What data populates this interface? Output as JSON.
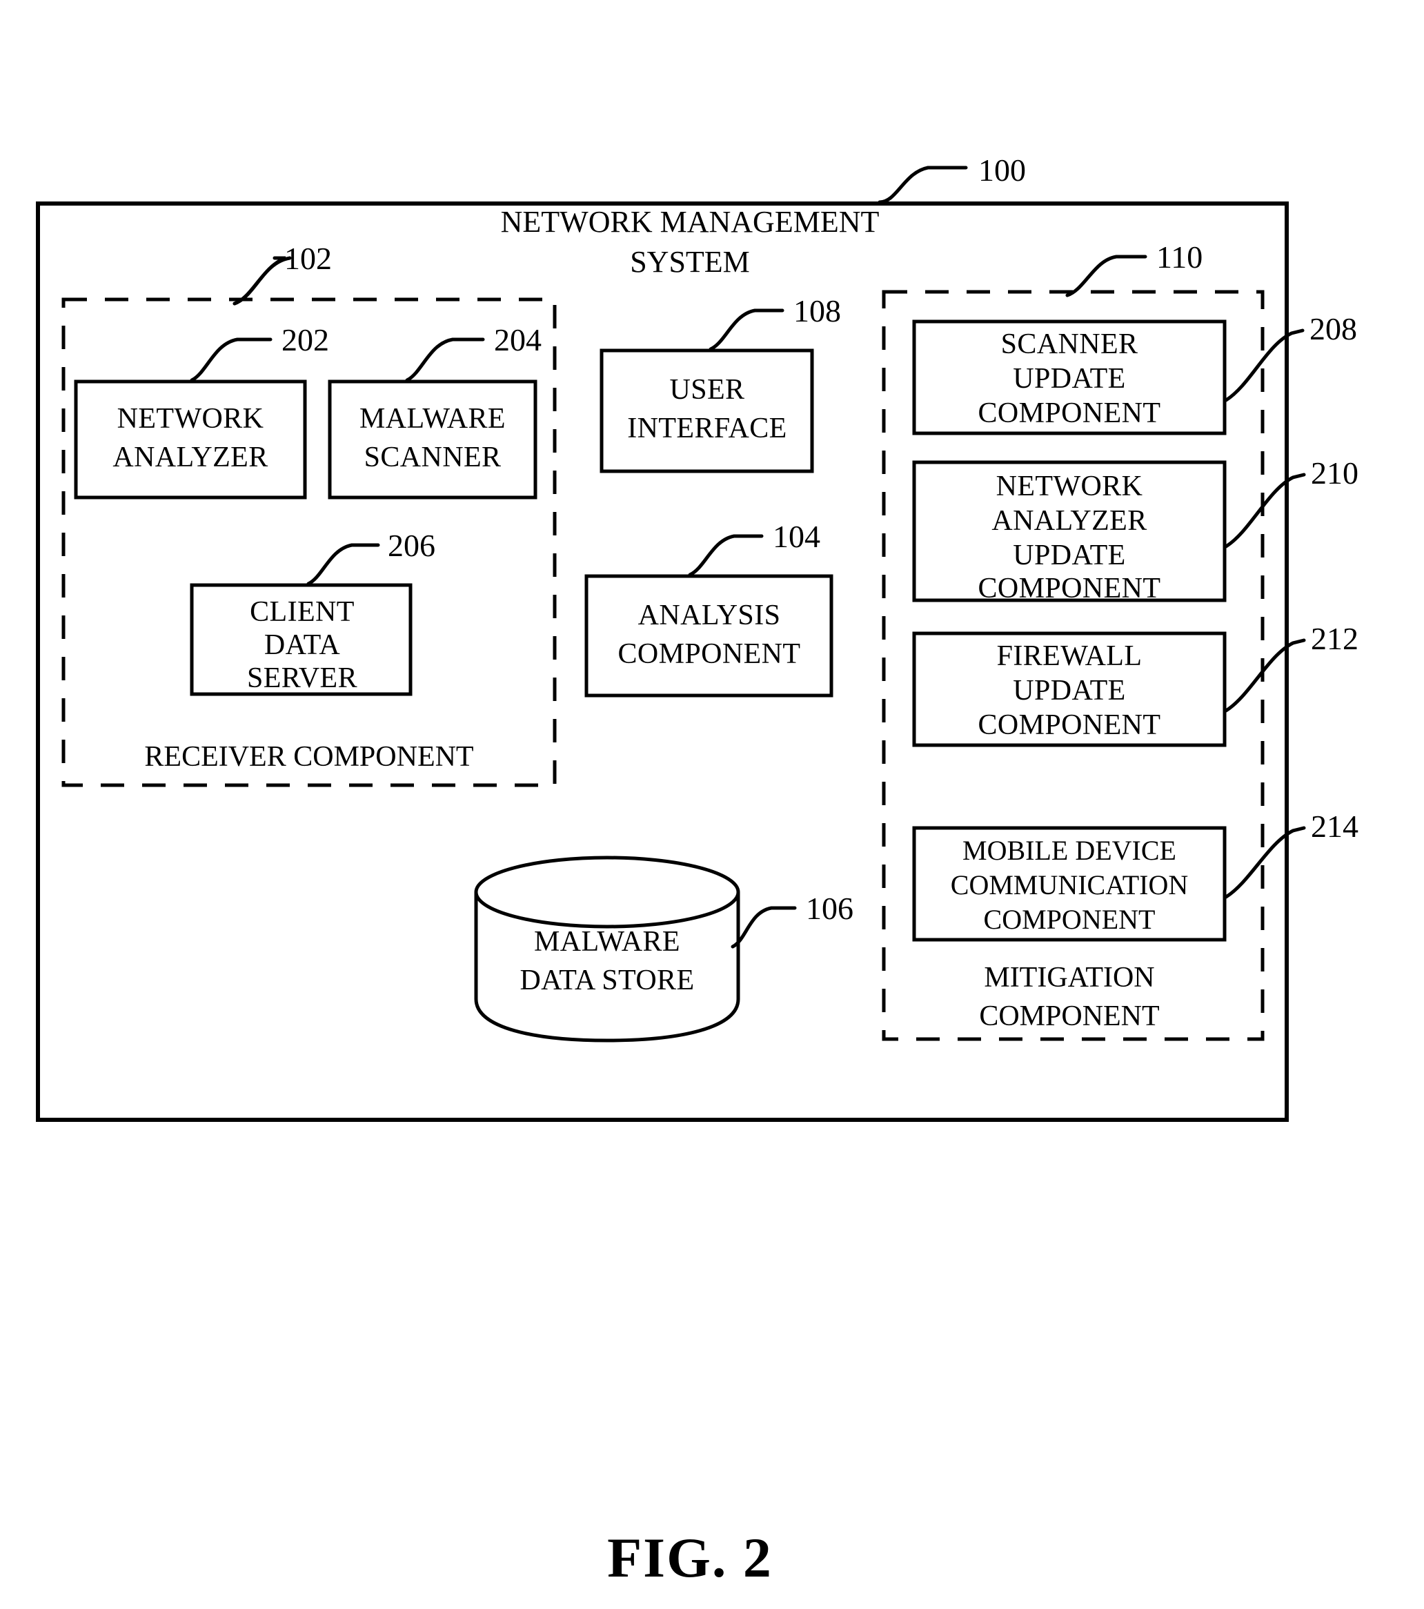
{
  "figure": {
    "caption": "FIG. 2",
    "system_title_line1": "NETWORK MANAGEMENT",
    "system_title_line2": "SYSTEM",
    "system_ref": "100"
  },
  "receiver_group": {
    "label": "RECEIVER COMPONENT",
    "ref": "102",
    "boxes": [
      {
        "ref": "202",
        "lines": [
          "NETWORK",
          "ANALYZER"
        ]
      },
      {
        "ref": "204",
        "lines": [
          "MALWARE",
          "SCANNER"
        ]
      },
      {
        "ref": "206",
        "lines": [
          "CLIENT",
          "DATA",
          "SERVER"
        ]
      }
    ]
  },
  "center_column": {
    "boxes": [
      {
        "ref": "108",
        "lines": [
          "USER",
          "INTERFACE"
        ]
      },
      {
        "ref": "104",
        "lines": [
          "ANALYSIS",
          "COMPONENT"
        ]
      }
    ],
    "data_store": {
      "ref": "106",
      "lines": [
        "MALWARE",
        "DATA STORE"
      ]
    }
  },
  "mitigation_group": {
    "label_line1": "MITIGATION",
    "label_line2": "COMPONENT",
    "ref": "110",
    "boxes": [
      {
        "ref": "208",
        "lines": [
          "SCANNER",
          "UPDATE",
          "COMPONENT"
        ]
      },
      {
        "ref": "210",
        "lines": [
          "NETWORK",
          "ANALYZER",
          "UPDATE",
          "COMPONENT"
        ]
      },
      {
        "ref": "212",
        "lines": [
          "FIREWALL",
          "UPDATE",
          "COMPONENT"
        ]
      },
      {
        "ref": "214",
        "lines": [
          "MOBILE DEVICE",
          "COMMUNICATION",
          "COMPONENT"
        ]
      }
    ]
  },
  "colors": {
    "ink": "#000000",
    "paper": "#ffffff"
  }
}
